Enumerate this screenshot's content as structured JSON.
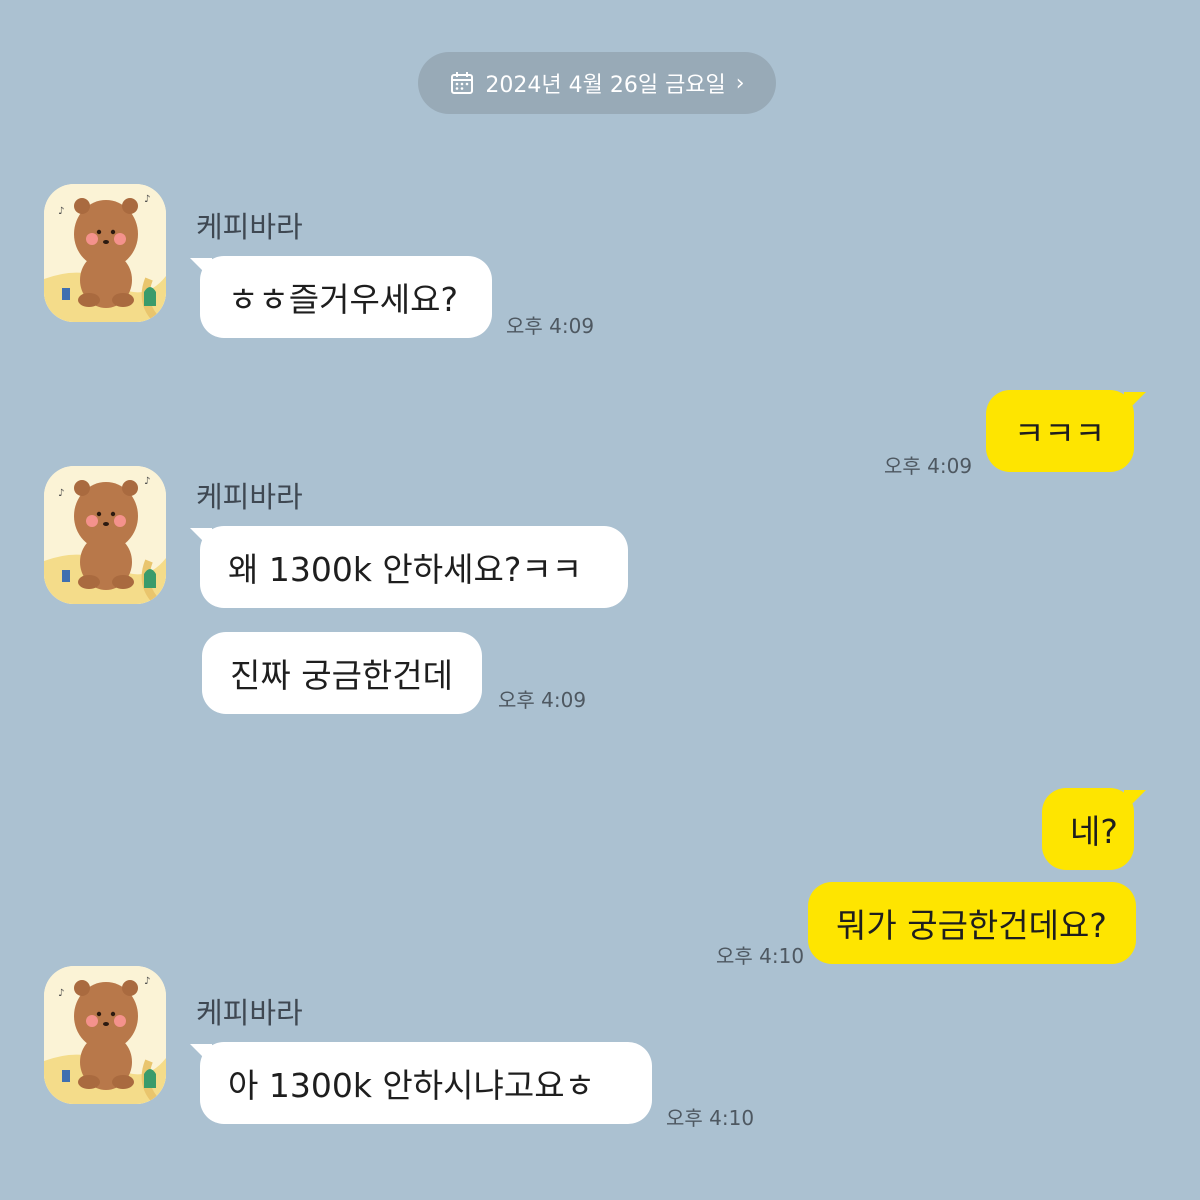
{
  "date_divider": {
    "label": "2024년 4월 26일 금요일",
    "chevron": "›",
    "icon": "calendar-icon"
  },
  "contact": {
    "name": "케피바라",
    "avatar_icon": "capybara-avatar"
  },
  "messages": [
    {
      "from": "other",
      "sender": "케피바라",
      "text": "ㅎㅎ즐거우세요?",
      "time": "오후 4:09"
    },
    {
      "from": "me",
      "text": "ㅋㅋㅋ",
      "time": "오후 4:09"
    },
    {
      "from": "other",
      "sender": "케피바라",
      "text": "왜 1300k 안하세요?ㅋㅋ"
    },
    {
      "from": "other",
      "text": "진짜 궁금한건데",
      "time": "오후 4:09"
    },
    {
      "from": "me",
      "text": "네?"
    },
    {
      "from": "me",
      "text": "뭐가 궁금한건데요?",
      "time": "오후 4:10"
    },
    {
      "from": "other",
      "sender": "케피바라",
      "text": "아 1300k 안하시냐고요ㅎ",
      "time": "오후 4:10"
    }
  ],
  "colors": {
    "background": "#abc1d1",
    "outgoing_bubble": "#fee500",
    "incoming_bubble": "#ffffff",
    "date_pill": "#98aab7"
  }
}
